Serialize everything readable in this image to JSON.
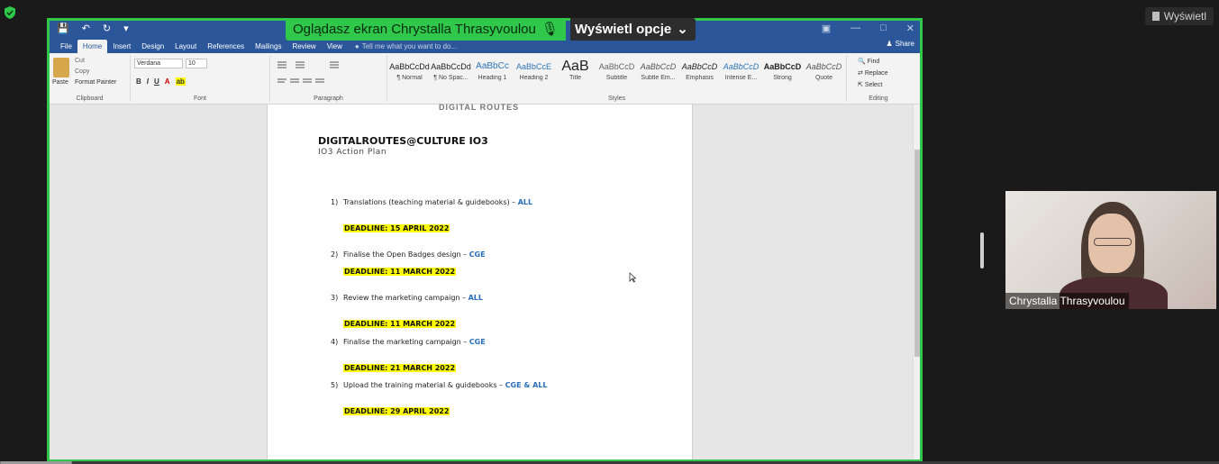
{
  "zoom": {
    "viewing_banner": "Oglądasz ekran Chrystalla Thrasyvoulou",
    "view_options": "Wyświetl opcje",
    "top_view_button": "Wyświetl",
    "accent_green": "#2fc84a"
  },
  "word": {
    "ribbon_tabs": [
      "File",
      "Home",
      "Insert",
      "Design",
      "Layout",
      "References",
      "Mailings",
      "Review",
      "View"
    ],
    "active_tab": "Home",
    "tell_me": "Tell me what you want to do...",
    "share": "Share",
    "clipboard": {
      "paste": "Paste",
      "cut": "Cut",
      "copy": "Copy",
      "format_painter": "Format Painter",
      "label": "Clipboard"
    },
    "font": {
      "family": "Verdana",
      "size": "10",
      "label": "Font",
      "bold": "B",
      "italic": "I",
      "underline": "U"
    },
    "paragraph_label": "Paragraph",
    "styles_label": "Styles",
    "styles": [
      {
        "sample": "AaBbCcDd",
        "name": "¶ Normal"
      },
      {
        "sample": "AaBbCcDd",
        "name": "¶ No Spac..."
      },
      {
        "sample": "AaBbCc",
        "name": "Heading 1"
      },
      {
        "sample": "AaBbCcE",
        "name": "Heading 2"
      },
      {
        "sample": "AaB",
        "name": "Title"
      },
      {
        "sample": "AaBbCcD",
        "name": "Subtitle"
      },
      {
        "sample": "AaBbCcD",
        "name": "Subtle Em..."
      },
      {
        "sample": "AaBbCcD",
        "name": "Emphasis"
      },
      {
        "sample": "AaBbCcD",
        "name": "Intense E..."
      },
      {
        "sample": "AaBbCcD",
        "name": "Strong"
      },
      {
        "sample": "AaBbCcD",
        "name": "Quote"
      }
    ],
    "editing": {
      "find": "Find",
      "replace": "Replace",
      "select": "Select",
      "label": "Editing"
    }
  },
  "document": {
    "header_logo": "DIGITAL ROUTES",
    "title": "DIGITALROUTES@CULTURE IO3",
    "subtitle": "IO3 Action Plan",
    "items": [
      {
        "num": "1)",
        "text": "Translations (teaching material & guidebooks) – ",
        "who": "ALL",
        "deadline": "DEADLINE: 15 APRIL 2022"
      },
      {
        "num": "2)",
        "text": "Finalise the Open Badges design – ",
        "who": "CGE",
        "deadline": "DEADLINE: 11 MARCH 2022"
      },
      {
        "num": "3)",
        "text": "Review the marketing campaign – ",
        "who": "ALL",
        "deadline": "DEADLINE: 11 MARCH 2022"
      },
      {
        "num": "4)",
        "text": "Finalise the marketing campaign – ",
        "who": "CGE",
        "deadline": "DEADLINE: 21 MARCH 2022"
      },
      {
        "num": "5)",
        "text": "Upload the training material & guidebooks – ",
        "who": "CGE & ALL",
        "deadline": "DEADLINE: 29 APRIL 2022"
      }
    ]
  },
  "participant": {
    "name": "Chrystalla Thrasyvoulou"
  }
}
